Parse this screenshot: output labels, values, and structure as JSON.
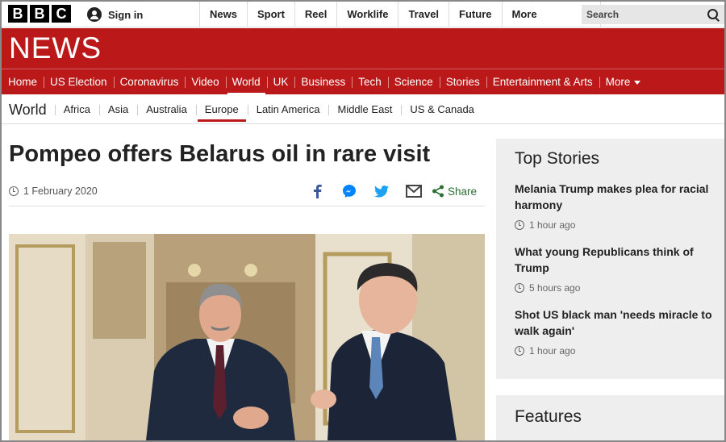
{
  "global_nav": {
    "logo_letters": [
      "B",
      "B",
      "C"
    ],
    "sign_in": "Sign in",
    "items": [
      "News",
      "Sport",
      "Reel",
      "Worklife",
      "Travel",
      "Future"
    ],
    "more": "More",
    "search_placeholder": "Search"
  },
  "masthead": {
    "logo": "NEWS",
    "color": "#bb1919"
  },
  "main_nav": {
    "items": [
      "Home",
      "US Election",
      "Coronavirus",
      "Video",
      "World",
      "UK",
      "Business",
      "Tech",
      "Science",
      "Stories",
      "Entertainment & Arts"
    ],
    "active": "World",
    "more": "More"
  },
  "sub_nav": {
    "section": "World",
    "items": [
      "Africa",
      "Asia",
      "Australia",
      "Europe",
      "Latin America",
      "Middle East",
      "US & Canada"
    ],
    "active": "Europe"
  },
  "article": {
    "headline": "Pompeo offers Belarus oil in rare visit",
    "date": "1 February 2020",
    "share_label": "Share",
    "share_icons": [
      "facebook-icon",
      "messenger-icon",
      "twitter-icon",
      "email-icon",
      "share-icon"
    ]
  },
  "top_stories": {
    "title": "Top Stories",
    "items": [
      {
        "title": "Melania Trump makes plea for racial harmony",
        "time": "1 hour ago"
      },
      {
        "title": "What young Republicans think of Trump",
        "time": "5 hours ago"
      },
      {
        "title": "Shot US black man 'needs miracle to walk again'",
        "time": "1 hour ago"
      }
    ]
  },
  "features": {
    "title": "Features"
  }
}
